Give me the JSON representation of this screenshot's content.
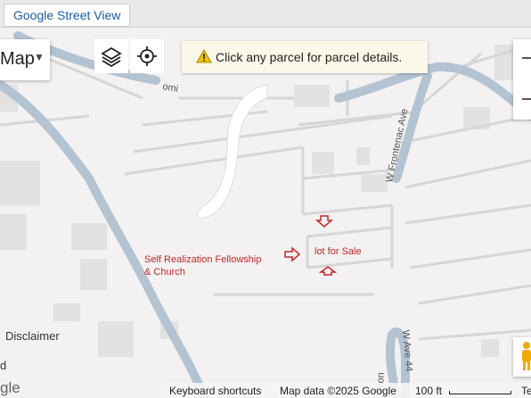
{
  "top_bar": {
    "street_view_label": "Google Street View"
  },
  "map_controls": {
    "map_type_label": "Map",
    "info_message": "Click any parcel for parcel details."
  },
  "map_labels": {
    "street_1": "W Frontenac Ave",
    "street_2": "Fron",
    "street_3": "W Ave 44",
    "street_4": "omi",
    "disclaimer": "Disclaimer",
    "left_fragment": "d",
    "google_fragment": "gle"
  },
  "annotations": {
    "fellowship_line1": "Self Realization Fellowship",
    "fellowship_line2": "& Church",
    "lot_label": "lot for Sale",
    "arrow_color": "#c0282a"
  },
  "attribution": {
    "keyboard_shortcuts": "Keyboard shortcuts",
    "map_data": "Map data ©2025 Google",
    "scale_label": "100 ft",
    "terms_fragment": "Te"
  }
}
